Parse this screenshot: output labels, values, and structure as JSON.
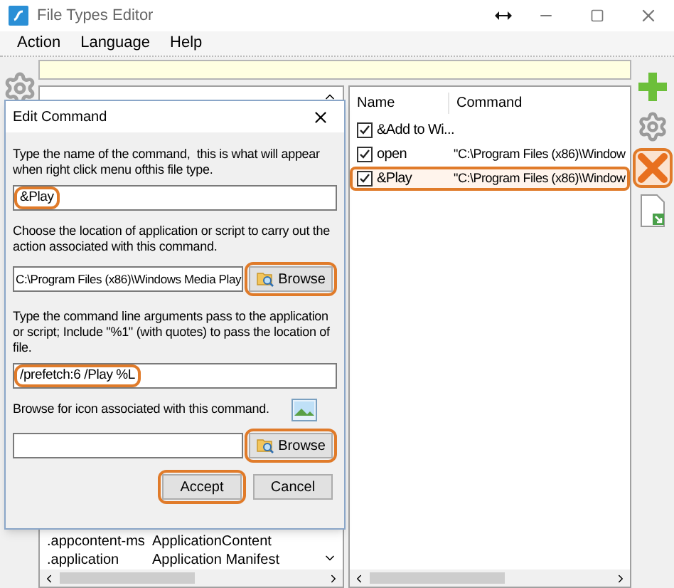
{
  "window": {
    "title": "File Types Editor"
  },
  "menu": [
    "Action",
    "Language",
    "Help"
  ],
  "file_types": {
    "rows": [
      {
        "extension": ".appcontent-ms",
        "file_type": "ApplicationContent"
      },
      {
        "extension": ".application",
        "file_type": "Application Manifest"
      }
    ]
  },
  "commands": {
    "columns": [
      "Name",
      "Command"
    ],
    "rows": [
      {
        "name": "&Add to Wi...",
        "checked": true,
        "selected": false
      },
      {
        "name": "open",
        "command": "\"C:\\Program Files (x86)\\Window",
        "checked": true,
        "selected": false
      },
      {
        "name": "&Play",
        "command": "\"C:\\Program Files (x86)\\Window",
        "checked": true,
        "selected": true
      }
    ]
  },
  "toolbar": [
    {
      "kind": "add"
    },
    {
      "kind": "settings"
    },
    {
      "kind": "delete",
      "highlighted": true
    },
    {
      "kind": "export"
    }
  ],
  "dialog": {
    "title": "Edit Command",
    "sections": [
      {
        "prompt": "Type the name of the command,  this is what will appear when right click menu ofthis file type.",
        "value": "&Play",
        "value_highlighted": true
      },
      {
        "prompt": "Choose the location of application or script to carry out the action associated with this command.",
        "value": "C:\\Program Files (x86)\\Windows Media Play",
        "button": {
          "label": "Browse",
          "highlighted": true
        }
      },
      {
        "prompt": "Type the command line arguments pass to the application or script; Include \"%1\" (with quotes) to pass the location of file.",
        "value": "/prefetch:6 /Play %L",
        "value_highlighted": true
      },
      {
        "prompt": "Browse for icon associated with this command.",
        "kind": "icon",
        "button": {
          "label": "Browse",
          "highlighted": true
        }
      }
    ],
    "buttons": [
      {
        "label": "Accept",
        "highlighted": true
      },
      {
        "label": "Cancel",
        "highlighted": false
      }
    ]
  }
}
